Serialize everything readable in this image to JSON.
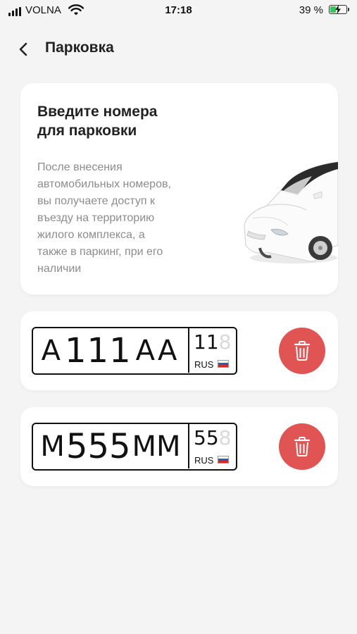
{
  "status_bar": {
    "carrier": "VOLNA",
    "time": "17:18",
    "battery": "39 %",
    "battery_level": 0.39
  },
  "header": {
    "title": "Парковка"
  },
  "info_card": {
    "title": "Введите номера\nдля парковки",
    "description": "После внесения\nавтомобильных номеров,\nвы получаете доступ к\nвъезду на территорию\nжилого комплекса, а\nтакже в паркинг, при его\nналичии"
  },
  "plates": [
    {
      "letter1": "А",
      "digits": "111",
      "letters2": "АА",
      "region": "11",
      "region_ghost": "8",
      "country": "RUS"
    },
    {
      "letter1": "М",
      "digits": "555",
      "letters2": "ММ",
      "region": "55",
      "region_ghost": "8",
      "country": "RUS"
    }
  ],
  "colors": {
    "accent_delete": "#e15454",
    "background": "#f4f4f4",
    "card": "#ffffff",
    "muted_text": "#8c8c8c"
  },
  "icons": [
    "signal-icon",
    "wifi-icon",
    "battery-icon",
    "back-chevron-icon",
    "car-illustration",
    "trash-icon",
    "russia-flag-icon"
  ]
}
